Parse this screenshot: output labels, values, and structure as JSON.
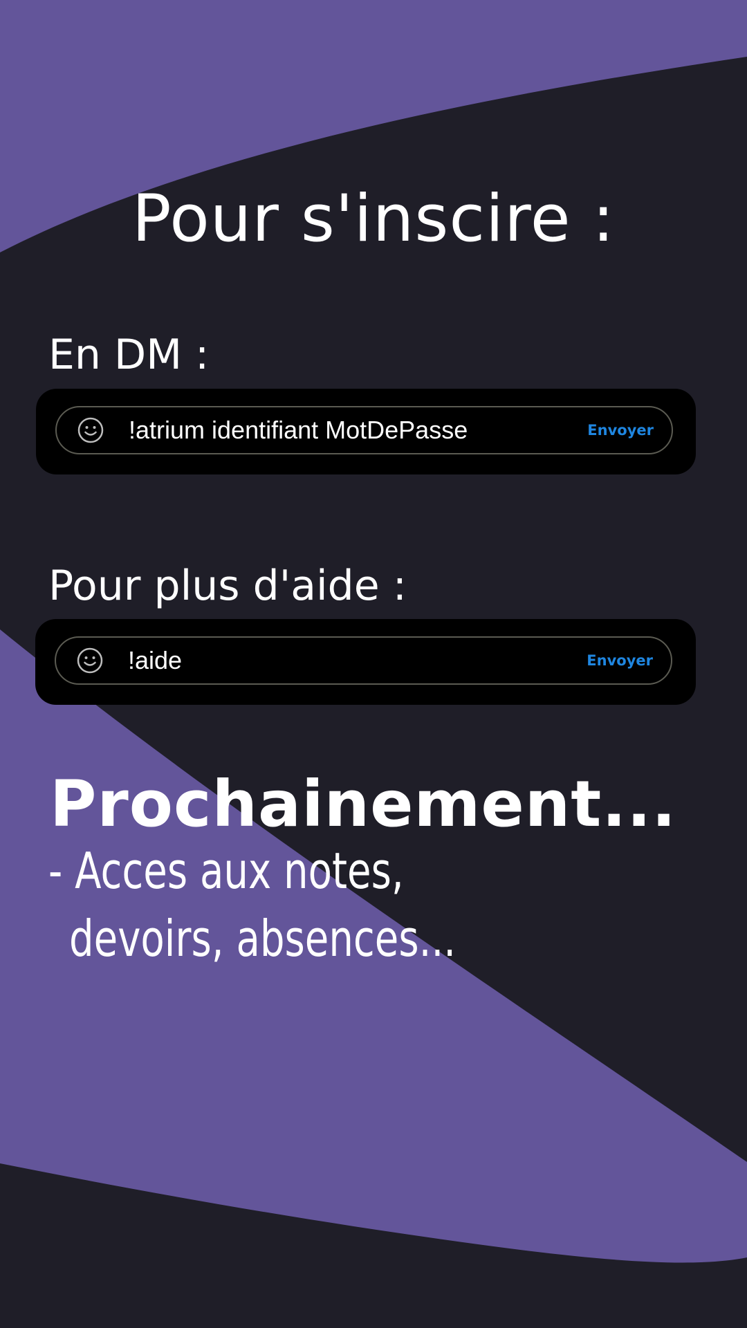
{
  "colors": {
    "background": "#1f1e28",
    "accent_purple": "#63559a",
    "panel": "#000000",
    "field_border": "#5b5b52",
    "send": "#1f86e0",
    "text": "#ffffff"
  },
  "title": "Pour s'inscire :",
  "dm_section": {
    "label": "En DM :",
    "input_icon": "smile-icon",
    "command": "!atrium identifiant MotDePasse",
    "send_label": "Envoyer"
  },
  "help_section": {
    "label": "Pour plus d'aide :",
    "input_icon": "smile-icon",
    "command": "!aide",
    "send_label": "Envoyer"
  },
  "upcoming": {
    "title": "Prochainement...",
    "lines": [
      "- Acces aux notes,",
      "devoirs, absences..."
    ]
  }
}
